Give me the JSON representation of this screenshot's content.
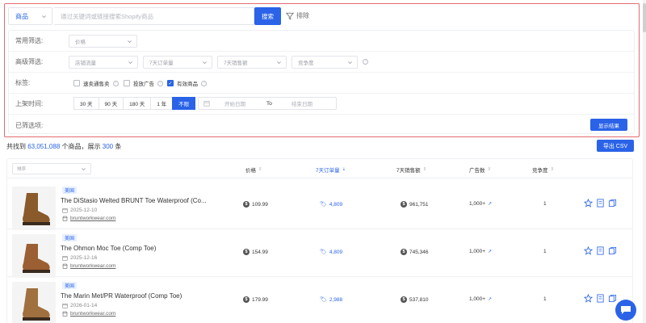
{
  "search": {
    "category": "商品",
    "placeholder": "通过关键词或链接搜索Shopify商品",
    "button": "搜索",
    "exclude": "排除"
  },
  "filters": {
    "common": {
      "label": "常用筛选:",
      "price": "价格"
    },
    "advanced": {
      "label": "高级筛选:",
      "store": "店铺流量",
      "orders7": "7天订单量",
      "sales7": "7天销售额",
      "competition": "竞争度"
    },
    "tags": {
      "label": "标签:",
      "items": [
        {
          "label": "速卖通售卖",
          "checked": false
        },
        {
          "label": "投放广告",
          "checked": false
        },
        {
          "label": "有效商品",
          "checked": true
        }
      ]
    },
    "listed": {
      "label": "上架时间:",
      "options": [
        "30 天",
        "90 天",
        "180 天",
        "1 年",
        "不限"
      ],
      "active_index": 4,
      "start_placeholder": "开始日期",
      "to": "To",
      "end_placeholder": "结束日期"
    },
    "selected": {
      "label": "已筛选项:",
      "show_button": "显示结果"
    }
  },
  "results": {
    "prefix": "共找到",
    "count": "63,051,088",
    "middle": "个商品，展示",
    "shown": "300",
    "suffix": "条",
    "export": "导出 CSV"
  },
  "table": {
    "sort_placeholder": "排序",
    "headers": {
      "price": "价格",
      "orders7": "7天订单量",
      "sales7": "7天销售额",
      "ads": "广告数",
      "competition": "竞争度"
    },
    "rows": [
      {
        "region": "美国",
        "title": "The DiStasio Welted BRUNT Toe Waterproof (Co...",
        "date": "2025-12-10",
        "store": "bruntworkwear.com",
        "price": "109.99",
        "orders": "4,809",
        "sales": "961,751",
        "ads": "1,000+",
        "competition": "1",
        "boot_color": "#8a5a2b"
      },
      {
        "region": "美国",
        "title": "The Ohmon Moc Toe (Comp Toe)",
        "date": "2025-12-16",
        "store": "bruntworkwear.com",
        "price": "154.99",
        "orders": "4,809",
        "sales": "745,346",
        "ads": "1,000+",
        "competition": "1",
        "boot_color": "#9b5f33"
      },
      {
        "region": "美国",
        "title": "The Marin Met/PR Waterproof (Comp Toe)",
        "date": "2026-01-14",
        "store": "bruntworkwear.com",
        "price": "179.99",
        "orders": "2,988",
        "sales": "537,810",
        "ads": "1,000+",
        "competition": "1",
        "boot_color": "#a0703f"
      }
    ]
  },
  "colors": {
    "accent": "#2a63e8",
    "panel_border": "#e46a6f"
  }
}
